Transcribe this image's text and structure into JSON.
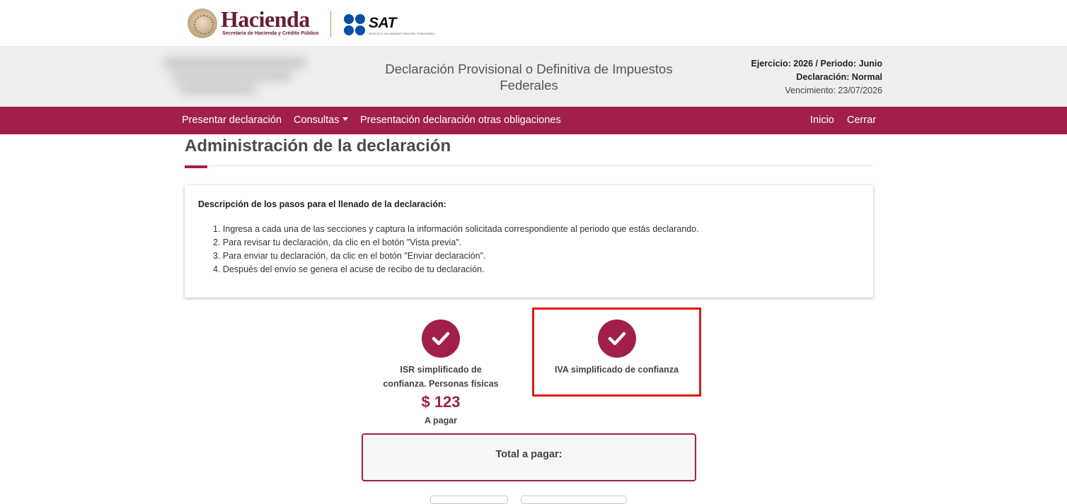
{
  "branding": {
    "hacienda_title": "Hacienda",
    "hacienda_subtitle": "Secretaría de Hacienda y Crédito Público",
    "sat_title": "SAT",
    "sat_subtitle": "SERVICIO DE ADMINISTRACIÓN TRIBUTARIA"
  },
  "header": {
    "document_title": "Declaración Provisional o Definitiva de Impuestos Federales",
    "exercise_period": "Ejercicio: 2026 / Periodo: Junio",
    "declaration_type": "Declaración: Normal",
    "due_date": "Vencimiento: 23/07/2026"
  },
  "nav": {
    "present": "Presentar declaración",
    "queries": "Consultas",
    "other_obligations": "Presentación declaración otras obligaciones",
    "home": "Inicio",
    "close": "Cerrar"
  },
  "page": {
    "title": "Administración de la declaración"
  },
  "steps": {
    "heading": "Descripción de los pasos para el llenado de la declaración:",
    "items": [
      "1. Ingresa a cada una de las secciones y captura la información solicitada correspondiente al periodo que estás declarando.",
      "2. Para revisar tu declaración, da clic en el botón \"Vista previa\".",
      "3. Para enviar tu declaración, da clic en el botón \"Enviar declaración\".",
      "4. Después del envío se genera el acuse de recibo de tu declaración."
    ]
  },
  "sections": [
    {
      "label_line1": "ISR simplificado de",
      "label_line2": "confianza. Personas físicas",
      "amount": "$ 123",
      "amount_caption": "A pagar",
      "icon": "check-icon",
      "status": "complete"
    },
    {
      "label_line1": "IVA simplificado de confianza",
      "icon": "check-icon",
      "status": "complete"
    }
  ],
  "total": {
    "label": "Total a pagar:"
  },
  "colors": {
    "primary": "#a0204a",
    "highlight": "#e01a1a",
    "hacienda": "#691c32",
    "sat_blue": "#0a4fa6"
  }
}
